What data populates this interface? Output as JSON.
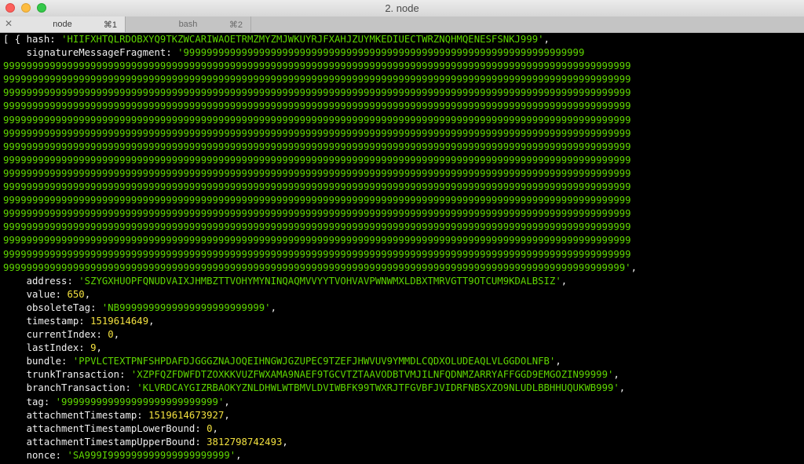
{
  "window": {
    "title": "2. node",
    "tabs": [
      {
        "label": "node",
        "shortcut": "⌘1"
      },
      {
        "label": "bash",
        "shortcut": "⌘2"
      }
    ]
  },
  "terminal": {
    "opening": "[ { ",
    "fields": {
      "hash": {
        "key": "hash",
        "value": "'HIIFXHTQLRDOBXYQ9TKZWCARIWAOETRMZMYZMJWKUYRJFXAHJZUYMKEDIUECTWRZNQHMQENESFSNKJ999'"
      },
      "signatureMessageFragment": {
        "key": "signatureMessageFragment",
        "value_first": "'999999999999999999999999999999999999999999999999999999999999999999999",
        "value_lines": [
          "999999999999999999999999999999999999999999999999999999999999999999999999999999999999999999999999999999999999",
          "999999999999999999999999999999999999999999999999999999999999999999999999999999999999999999999999999999999999",
          "999999999999999999999999999999999999999999999999999999999999999999999999999999999999999999999999999999999999",
          "999999999999999999999999999999999999999999999999999999999999999999999999999999999999999999999999999999999999",
          "999999999999999999999999999999999999999999999999999999999999999999999999999999999999999999999999999999999999",
          "999999999999999999999999999999999999999999999999999999999999999999999999999999999999999999999999999999999999",
          "999999999999999999999999999999999999999999999999999999999999999999999999999999999999999999999999999999999999",
          "999999999999999999999999999999999999999999999999999999999999999999999999999999999999999999999999999999999999",
          "999999999999999999999999999999999999999999999999999999999999999999999999999999999999999999999999999999999999",
          "999999999999999999999999999999999999999999999999999999999999999999999999999999999999999999999999999999999999",
          "999999999999999999999999999999999999999999999999999999999999999999999999999999999999999999999999999999999999",
          "999999999999999999999999999999999999999999999999999999999999999999999999999999999999999999999999999999999999",
          "999999999999999999999999999999999999999999999999999999999999999999999999999999999999999999999999999999999999",
          "999999999999999999999999999999999999999999999999999999999999999999999999999999999999999999999999999999999999",
          "999999999999999999999999999999999999999999999999999999999999999999999999999999999999999999999999999999999999"
        ],
        "value_last": "99999999999999999999999999999999999999999999999999999999999999999999999999999999999999999999999999999999999'"
      },
      "address": {
        "key": "address",
        "value": "'SZYGXHUOPFQNUDVAIXJHMBZTTVOHYMYNINQAQMVVYYTVOHVAVPWNWMXLDBXTMRVGTT9OTCUM9KDALBSIZ'"
      },
      "value": {
        "key": "value",
        "value": "650"
      },
      "obsoleteTag": {
        "key": "obsoleteTag",
        "value": "'NB9999999999999999999999999'"
      },
      "timestamp": {
        "key": "timestamp",
        "value": "1519614649"
      },
      "currentIndex": {
        "key": "currentIndex",
        "value": "0"
      },
      "lastIndex": {
        "key": "lastIndex",
        "value": "9"
      },
      "bundle": {
        "key": "bundle",
        "value": "'PPVLCTEXTPNFSHPDAFDJGGGZNAJOQEIHNGWJGZUPEC9TZEFJHWVUV9YMMDLCQDXOLUDEAQLVLGGDOLNFB'"
      },
      "trunkTransaction": {
        "key": "trunkTransaction",
        "value": "'XZPFQZFDWFDTZOXKKVUZFWXAMA9NAEF9TGCVTZTAAVODBTVMJILNFQDNMZARRYAFFGGD9EMGOZIN99999'"
      },
      "branchTransaction": {
        "key": "branchTransaction",
        "value": "'KLVRDCAYGIZRBAOKYZNLDHWLWTBMVLDVIWBFK99TWXRJTFGVBFJVIDRFNBSXZO9NLUDLBBHHUQUKWB999'"
      },
      "tag": {
        "key": "tag",
        "value": "'999999999999999999999999999'"
      },
      "attachmentTimestamp": {
        "key": "attachmentTimestamp",
        "value": "1519614673927"
      },
      "attachmentTimestampLowerBound": {
        "key": "attachmentTimestampLowerBound",
        "value": "0"
      },
      "attachmentTimestampUpperBound": {
        "key": "attachmentTimestampUpperBound",
        "value": "3812798742493"
      },
      "nonce": {
        "key": "nonce",
        "value": "'SA999I999999999999999999999'"
      },
      "persistence": {
        "key": "persistence",
        "value": "true"
      }
    },
    "closing": " },"
  }
}
